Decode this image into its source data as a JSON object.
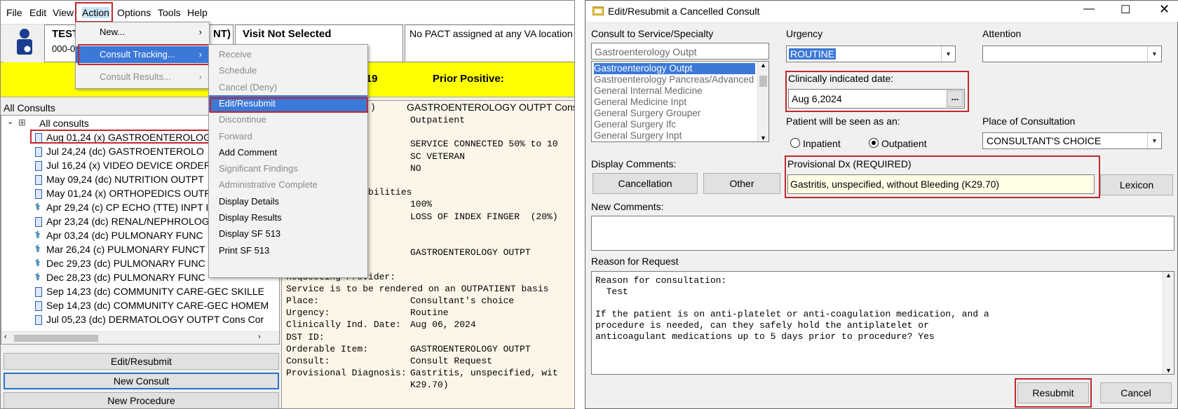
{
  "left": {
    "menubar": [
      "File",
      "Edit",
      "View",
      "Action",
      "Options",
      "Tools",
      "Help"
    ],
    "patient": {
      "name": "TEST",
      "name_tail": "NT)",
      "id": "000-00",
      "visit": "Visit Not Selected",
      "pact": "No PACT assigned at any VA location"
    },
    "yellow_bar": {
      "covid": "D-19",
      "prior": "Prior Positive:"
    },
    "tree": {
      "header": "All Consults",
      "root": "All consults",
      "items": [
        {
          "date": "Aug 01,24",
          "status": "(x)",
          "name": "GASTROENTEROLOG",
          "icon": "doc"
        },
        {
          "date": "Jul 24,24",
          "status": "(dc)",
          "name": "GASTROENTEROLO",
          "icon": "doc"
        },
        {
          "date": "Jul 16,24",
          "status": "(x)",
          "name": "VIDEO DEVICE ORDER",
          "icon": "doc"
        },
        {
          "date": "May 09,24",
          "status": "(dc)",
          "name": "NUTRITION OUTPT",
          "icon": "doc"
        },
        {
          "date": "May 01,24",
          "status": "(x)",
          "name": "ORTHOPEDICS OUTP",
          "icon": "doc"
        },
        {
          "date": "Apr 29,24",
          "status": "(c)",
          "name": "CP ECHO (TTE) INPT I",
          "icon": "caduceus"
        },
        {
          "date": "Apr 23,24",
          "status": "(dc)",
          "name": "RENAL/NEPHROLOG",
          "icon": "doc"
        },
        {
          "date": "Apr 03,24",
          "status": "(dc)",
          "name": "PULMONARY FUNC",
          "icon": "caduceus"
        },
        {
          "date": "Mar 26,24",
          "status": "(c)",
          "name": "PULMONARY FUNCT",
          "icon": "caduceus"
        },
        {
          "date": "Dec 29,23",
          "status": "(dc)",
          "name": "PULMONARY FUNC",
          "icon": "caduceus"
        },
        {
          "date": "Dec 28,23",
          "status": "(dc)",
          "name": "PULMONARY FUNC",
          "icon": "caduceus"
        },
        {
          "date": "Sep 14,23",
          "status": "(dc)",
          "name": "COMMUNITY CARE-GEC SKILLE",
          "icon": "doc"
        },
        {
          "date": "Sep 14,23",
          "status": "(dc)",
          "name": "COMMUNITY CARE-GEC HOMEM",
          "icon": "doc"
        },
        {
          "date": "Jul 05,23",
          "status": "(dc)",
          "name": "DERMATOLOGY OUTPT Cons Cor",
          "icon": "doc"
        }
      ]
    },
    "detail": {
      "header_left": ")",
      "header_right": "GASTROENTEROLOGY OUTPT Cons",
      "rows": [
        {
          "label": "tatus:",
          "value": "Outpatient"
        },
        {
          "label": "",
          "value": ""
        },
        {
          "label": "ility:",
          "value": "SERVICE CONNECTED 50% to 10"
        },
        {
          "label": "",
          "value": "SC VETERAN"
        },
        {
          "label": "",
          "value": "NO"
        },
        {
          "label": "",
          "value": ""
        },
        {
          "label": "tion/Rated Disabilities",
          "value": ""
        },
        {
          "label": "",
          "value": "100%"
        },
        {
          "label": "ies:",
          "value": "LOSS OF INDEX FINGER  (20%)"
        },
        {
          "label": "",
          "value": ""
        },
        {
          "label": "ion",
          "value": ""
        },
        {
          "label": "",
          "value": "GASTROENTEROLOGY OUTPT"
        },
        {
          "label": "",
          "value": ""
        },
        {
          "label": "Requesting Provider:",
          "value": ""
        },
        {
          "label": "Service is to be rendered on an OUTPATIENT basis",
          "value": ""
        },
        {
          "label": "Place:",
          "value": "Consultant's choice"
        },
        {
          "label": "Urgency:",
          "value": "Routine"
        },
        {
          "label": "Clinically Ind. Date:",
          "value": "Aug 06, 2024"
        },
        {
          "label": "DST ID:",
          "value": ""
        },
        {
          "label": "Orderable Item:",
          "value": "GASTROENTEROLOGY OUTPT"
        },
        {
          "label": "Consult:",
          "value": "Consult Request"
        },
        {
          "label": "Provisional Diagnosis:",
          "value": "Gastritis, unspecified, wit"
        },
        {
          "label": "",
          "value": "K29.70)"
        }
      ]
    },
    "buttons": {
      "edit_resubmit": "Edit/Resubmit",
      "new_consult": "New Consult",
      "new_procedure": "New Procedure"
    },
    "action_menu": {
      "new": "New...",
      "consult_tracking": "Consult Tracking...",
      "consult_results": "Consult Results..."
    },
    "tracking_menu": [
      {
        "label": "Receive",
        "enabled": false
      },
      {
        "label": "Schedule",
        "enabled": false
      },
      {
        "label": "Cancel (Deny)",
        "enabled": false
      },
      {
        "label": "Edit/Resubmit",
        "enabled": true,
        "selected": true
      },
      {
        "label": "Discontinue",
        "enabled": false
      },
      {
        "label": "Forward",
        "enabled": false
      },
      {
        "label": "Add Comment",
        "enabled": true
      },
      {
        "label": "Significant Findings",
        "enabled": false
      },
      {
        "label": "Administrative Complete",
        "enabled": false
      },
      {
        "label": "Display Details",
        "enabled": true
      },
      {
        "label": "Display Results",
        "enabled": true
      },
      {
        "label": "Display SF 513",
        "enabled": true
      },
      {
        "label": "Print SF 513",
        "enabled": true
      }
    ]
  },
  "right": {
    "title": "Edit/Resubmit a Cancelled Consult",
    "service_label": "Consult to Service/Specialty",
    "service_value": "Gastroenterology Outpt",
    "service_list": [
      "Gastroenterology Outpt",
      "Gastroenterology Pancreas/Advanced",
      "General Internal Medicine",
      "General Medicine Inpt",
      "General Surgery Grouper",
      "General Surgery Ifc",
      "General Surgery Inpt"
    ],
    "urgency_label": "Urgency",
    "urgency_value": "ROUTINE",
    "attention_label": "Attention",
    "attention_value": "",
    "clin_date_label": "Clinically indicated date:",
    "clin_date_value": "Aug 6,2024",
    "ellipsis": "...",
    "seen_as_label": "Patient will be seen as an:",
    "inpatient": "Inpatient",
    "outpatient": "Outpatient",
    "place_label": "Place of Consultation",
    "place_value": "CONSULTANT'S CHOICE",
    "display_comments_label": "Display Comments:",
    "cancellation": "Cancellation",
    "other": "Other",
    "prov_dx_label": "Provisional Dx (REQUIRED)",
    "prov_dx_value": "Gastritis, unspecified, without Bleeding (K29.70)",
    "lexicon": "Lexicon",
    "new_comments_label": "New Comments:",
    "reason_label": "Reason for Request",
    "reason_lines": [
      "Reason for consultation:",
      "  Test",
      "",
      "If the patient is on anti-platelet or anti-coagulation medication, and a",
      "procedure is needed, can they safely hold the antiplatelet or",
      "anticoagulant medications up to 5 days prior to procedure? Yes"
    ],
    "resubmit": "Resubmit",
    "cancel": "Cancel"
  }
}
